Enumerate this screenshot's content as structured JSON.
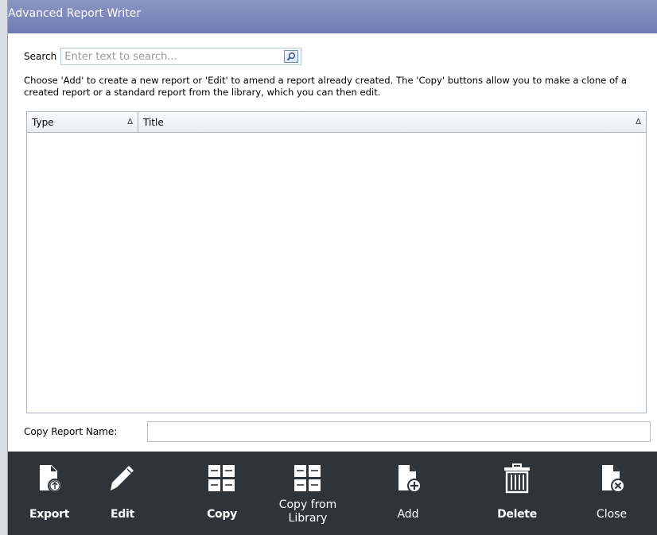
{
  "window": {
    "title": "Advanced Report Writer"
  },
  "search": {
    "label": "Search",
    "placeholder": "Enter text to search...",
    "value": ""
  },
  "instructions": "Choose 'Add' to create a new report or 'Edit' to amend a report already created. The 'Copy' buttons allow you to make a clone of a created report or a standard report from the library, which you can then edit.",
  "grid": {
    "columns": [
      {
        "label": "Type",
        "sort": "Δ"
      },
      {
        "label": "Title",
        "sort": "Δ"
      }
    ],
    "rows": []
  },
  "copy_report": {
    "label": "Copy Report Name:",
    "value": ""
  },
  "toolbar": {
    "export": {
      "label": "Export",
      "icon": "export-icon"
    },
    "edit": {
      "label": "Edit",
      "icon": "pencil-icon"
    },
    "copy": {
      "label": "Copy",
      "icon": "copy-icon"
    },
    "copy_library": {
      "label": "Copy from Library",
      "icon": "copy-library-icon"
    },
    "add": {
      "label": "Add",
      "icon": "add-document-icon"
    },
    "delete": {
      "label": "Delete",
      "icon": "trash-icon"
    },
    "close": {
      "label": "Close",
      "icon": "close-document-icon"
    }
  },
  "colors": {
    "titlebar": "#7a85ba",
    "toolbar_bg": "#2e3438",
    "icon": "#ffffff"
  }
}
